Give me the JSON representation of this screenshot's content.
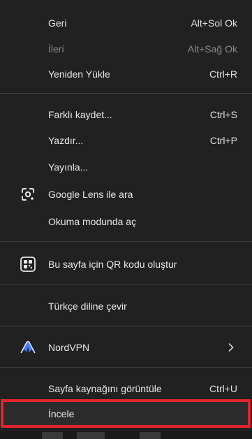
{
  "menu": {
    "items": [
      {
        "label": "Geri",
        "shortcut": "Alt+Sol Ok"
      },
      {
        "label": "İleri",
        "shortcut": "Alt+Sağ Ok"
      },
      {
        "label": "Yeniden Yükle",
        "shortcut": "Ctrl+R"
      },
      {
        "label": "Farklı kaydet...",
        "shortcut": "Ctrl+S"
      },
      {
        "label": "Yazdır...",
        "shortcut": "Ctrl+P"
      },
      {
        "label": "Yayınla..."
      },
      {
        "label": "Google Lens ile ara",
        "icon": "google-lens-icon"
      },
      {
        "label": "Okuma modunda aç"
      },
      {
        "label": "Bu sayfa için QR kodu oluştur",
        "icon": "qr-code-icon"
      },
      {
        "label": "Türkçe diline çevir"
      },
      {
        "label": "NordVPN",
        "icon": "nordvpn-icon"
      },
      {
        "label": "Sayfa kaynağını görüntüle",
        "shortcut": "Ctrl+U"
      },
      {
        "label": "İncele"
      }
    ]
  },
  "colors": {
    "background": "#212121",
    "text": "#e8e8e8",
    "disabled_text": "#8a8a8a",
    "separator": "#3d3d3d",
    "highlight_border": "#e3232c",
    "nordvpn": "#4b7bff"
  }
}
